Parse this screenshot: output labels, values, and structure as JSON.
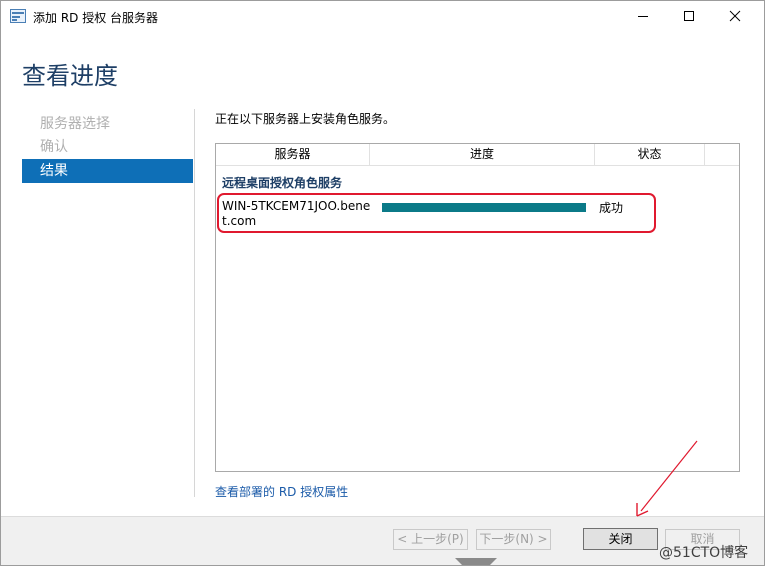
{
  "window": {
    "title": "添加 RD 授权 台服务器"
  },
  "page": {
    "title": "查看进度"
  },
  "nav": {
    "items": [
      {
        "label": "服务器选择",
        "state": "disabled"
      },
      {
        "label": "确认",
        "state": "disabled"
      },
      {
        "label": "结果",
        "state": "selected"
      }
    ]
  },
  "main": {
    "info": "正在以下服务器上安装角色服务。",
    "table": {
      "columns": [
        "服务器",
        "进度",
        "状态"
      ],
      "group": "远程桌面授权角色服务",
      "rows": [
        {
          "server": "WIN-5TKCEM71JOO.benet.com",
          "progress": 100,
          "status": "成功"
        }
      ]
    },
    "link": "查看部署的 RD 授权属性"
  },
  "footer": {
    "prev": "< 上一步(P)",
    "next": "下一步(N) >",
    "close": "关闭",
    "cancel": "取消"
  },
  "watermark": "@51CTO博客",
  "colors": {
    "accent": "#0e6fb7",
    "progress": "#0b7a88",
    "highlight": "#e0192f",
    "title": "#1e3f66"
  }
}
